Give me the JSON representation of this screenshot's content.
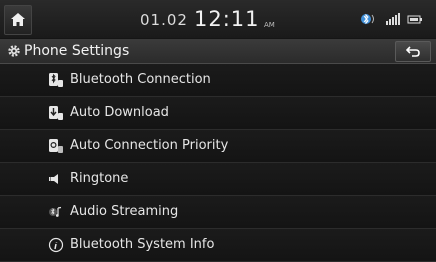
{
  "status": {
    "date": "01.02",
    "time": "12:11",
    "ampm": "AM"
  },
  "header": {
    "title": "Phone Settings"
  },
  "menu": {
    "items": [
      {
        "label": "Bluetooth Connection",
        "icon": "bluetooth-device-icon"
      },
      {
        "label": "Auto Download",
        "icon": "download-phone-icon"
      },
      {
        "label": "Auto Connection Priority",
        "icon": "priority-phone-icon"
      },
      {
        "label": "Ringtone",
        "icon": "ringtone-icon"
      },
      {
        "label": "Audio Streaming",
        "icon": "audio-streaming-icon"
      },
      {
        "label": "Bluetooth System Info",
        "icon": "info-icon"
      }
    ]
  },
  "colors": {
    "background": "#151515",
    "text": "#e6e6e6",
    "accent_blue": "#3f8fd9"
  }
}
